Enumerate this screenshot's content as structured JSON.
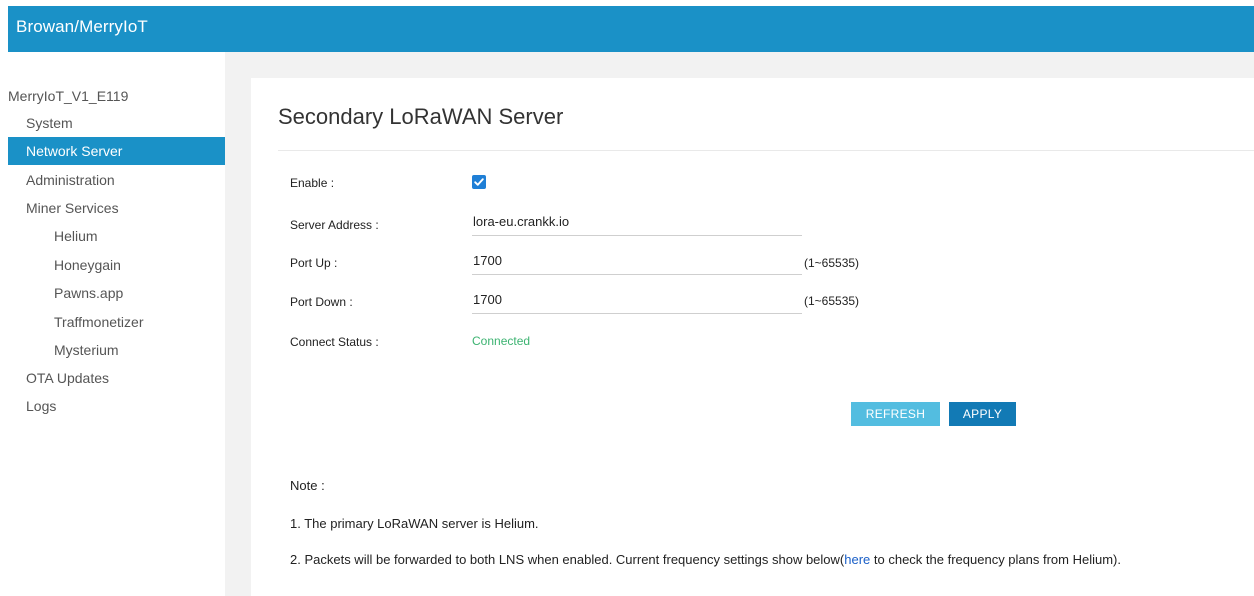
{
  "header": {
    "brand": "Browan/MerryIoT"
  },
  "sidebar": {
    "device_name": "MerryIoT_V1_E119",
    "items": [
      {
        "label": "System"
      },
      {
        "label": "Network Server"
      },
      {
        "label": "Administration"
      },
      {
        "label": "Miner Services"
      },
      {
        "label": "Helium"
      },
      {
        "label": "Honeygain"
      },
      {
        "label": "Pawns.app"
      },
      {
        "label": "Traffmonetizer"
      },
      {
        "label": "Mysterium"
      },
      {
        "label": "OTA Updates"
      },
      {
        "label": "Logs"
      }
    ],
    "active_item": "Network Server"
  },
  "main": {
    "title": "Secondary LoRaWAN Server",
    "form": {
      "enable_label": "Enable :",
      "enable_checked": true,
      "server_address_label": "Server Address :",
      "server_address_value": "lora-eu.crankk.io",
      "port_up_label": "Port Up :",
      "port_up_value": "1700",
      "port_up_range": "(1~65535)",
      "port_down_label": "Port Down :",
      "port_down_value": "1700",
      "port_down_range": "(1~65535)",
      "connect_status_label": "Connect Status :",
      "connect_status_value": "Connected"
    },
    "buttons": {
      "refresh": "REFRESH",
      "apply": "APPLY"
    },
    "note": {
      "title": "Note :",
      "line1": "1. The primary LoRaWAN server is Helium.",
      "line2_before": "2. Packets will be forwarded to both LNS when enabled. Current frequency settings show below(",
      "line2_link": "here",
      "line2_after": " to check the frequency plans from Helium)."
    }
  },
  "colors": {
    "header_bg": "#1a91c7",
    "active_nav_bg": "#1a91c7",
    "status_connected": "#3cb371",
    "refresh_button": "#53bde0",
    "apply_button": "#127ab5",
    "link": "#1a5fc7"
  },
  "icons": {
    "enable_checkbox": "checkmark-icon"
  }
}
